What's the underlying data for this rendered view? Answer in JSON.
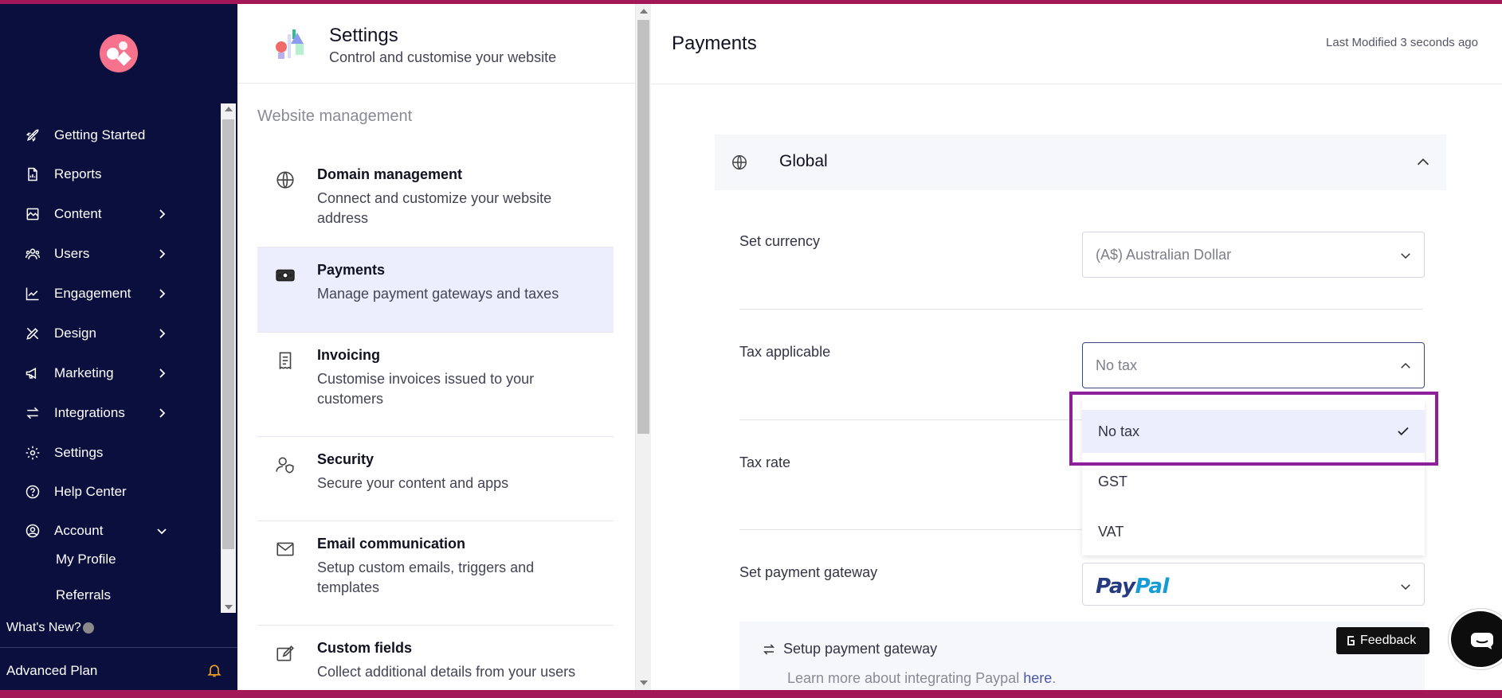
{
  "sidebar": {
    "items": [
      {
        "label": "Getting Started",
        "icon": "rocket-icon"
      },
      {
        "label": "Reports",
        "icon": "report-icon"
      },
      {
        "label": "Content",
        "icon": "content-icon"
      },
      {
        "label": "Users",
        "icon": "users-icon"
      },
      {
        "label": "Engagement",
        "icon": "chart-line-icon"
      },
      {
        "label": "Design",
        "icon": "design-icon"
      },
      {
        "label": "Marketing",
        "icon": "megaphone-icon"
      },
      {
        "label": "Integrations",
        "icon": "arrows-exchange-icon"
      },
      {
        "label": "Settings",
        "icon": "gear-icon"
      },
      {
        "label": "Help Center",
        "icon": "help-icon"
      },
      {
        "label": "Account",
        "icon": "user-circle-icon"
      }
    ],
    "account_sub": [
      "My Profile",
      "Referrals"
    ],
    "whats_new": "What's New?",
    "plan": "Advanced Plan"
  },
  "settings": {
    "title": "Settings",
    "subtitle": "Control and customise your website",
    "section": "Website management",
    "items": [
      {
        "title": "Domain management",
        "desc": "Connect and customize your website address",
        "icon": "globe-icon"
      },
      {
        "title": "Payments",
        "desc": "Manage payment gateways and taxes",
        "icon": "money-icon"
      },
      {
        "title": "Invoicing",
        "desc": "Customise invoices issued to your customers",
        "icon": "receipt-icon"
      },
      {
        "title": "Security",
        "desc": "Secure your content and apps",
        "icon": "user-shield-icon"
      },
      {
        "title": "Email communication",
        "desc": "Setup custom emails, triggers and templates",
        "icon": "mail-icon"
      },
      {
        "title": "Custom fields",
        "desc": "Collect additional details from your users",
        "icon": "edit-icon"
      }
    ]
  },
  "main": {
    "title": "Payments",
    "last_modified": "Last Modified 3 seconds ago",
    "global_title": "Global",
    "currency_label": "Set currency",
    "currency_value": "(A$) Australian Dollar",
    "tax_label": "Tax applicable",
    "tax_value": "No tax",
    "tax_options": [
      "No tax",
      "GST",
      "VAT"
    ],
    "tax_rate_label": "Tax rate",
    "gateway_label": "Set payment gateway",
    "gateway_logo_a": "Pay",
    "gateway_logo_b": "Pal",
    "setup_title": "Setup payment gateway",
    "setup_desc": "Learn more about integrating Paypal",
    "setup_link": "here",
    "setup_period": "."
  },
  "feedback": "Feedback",
  "colors": {
    "frame": "#a31657",
    "sidebar_bg": "#0a0f3d",
    "active_bg": "#eceefe",
    "highlight": "#8e1f9b"
  }
}
